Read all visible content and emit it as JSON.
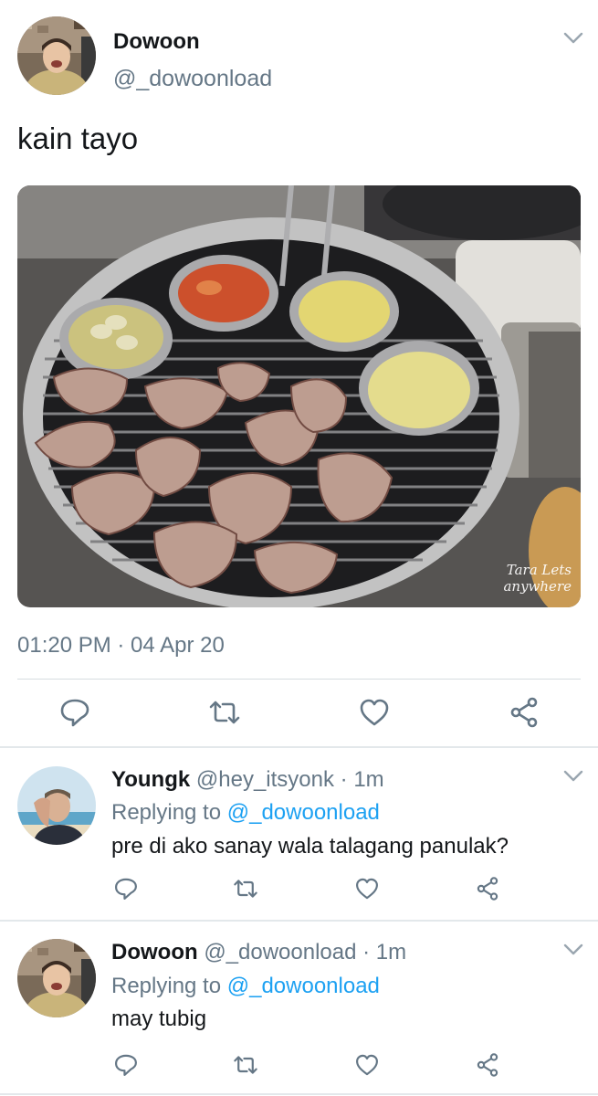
{
  "tweet": {
    "name": "Dowoon",
    "handle": "@_dowoonload",
    "text": "kain tayo",
    "timestamp": "01:20 PM · 04 Apr 20",
    "photo": {
      "watermark_line1": "Tara Lets",
      "watermark_line2": "anywhere"
    }
  },
  "replies": [
    {
      "name": "Youngk",
      "handle": "@hey_itsyonk",
      "time_sep": " · ",
      "time": "1m",
      "replying_prefix": "Replying to ",
      "replying_handle": "@_dowoonload",
      "text": "pre di ako sanay wala talagang panulak?"
    },
    {
      "name": "Dowoon",
      "handle": "@_dowoonload",
      "time_sep": " · ",
      "time": "1m",
      "replying_prefix": "Replying to ",
      "replying_handle": "@_dowoonload",
      "text": "may tubig"
    }
  ],
  "icons": [
    "reply-icon",
    "retweet-icon",
    "like-icon",
    "share-icon",
    "chevron-down-icon"
  ],
  "colors": {
    "text": "#14171a",
    "secondary": "#657786",
    "link": "#1da1f2",
    "divider": "#e3e8eb"
  }
}
